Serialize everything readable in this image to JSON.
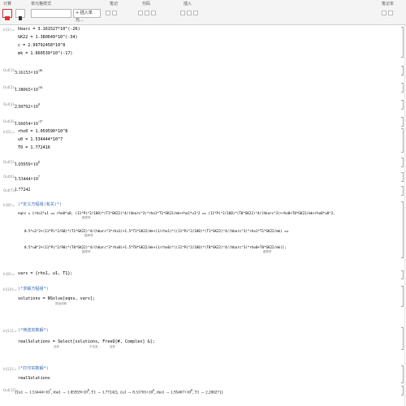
{
  "toolbar": {
    "groups": [
      "计算",
      "单元格样式",
      "笔记",
      "代码",
      "插入",
      "笔记本"
    ],
    "style_select": "",
    "insert_label": "+ 插入单元..."
  },
  "cells": {
    "in1": {
      "label": "In[1]:=",
      "l1": "hbarc = 3.161527*10^(-26)",
      "l2": "GK22 = 1.380649*10^(-34)",
      "l3": "c = 2.99792458*10^8",
      "l4": "mk = 1.660539*10^(-17)"
    },
    "out1": [
      {
        "label": "Out[1]=",
        "mant": "3.16153",
        "exp": "-26"
      },
      {
        "label": "Out[2]=",
        "mant": "1.38065",
        "exp": "-34"
      },
      {
        "label": "Out[3]=",
        "mant": "2.99792",
        "exp": "8"
      },
      {
        "label": "Out[4]=",
        "mant": "1.66054",
        "exp": "-17"
      }
    ],
    "in2": {
      "label": "In[5]:=",
      "l1": "rho0 = 1.059590*10^8",
      "l2": "u0 = 1.534444*10^7",
      "l3": "T0 = 1.772416"
    },
    "out2": [
      {
        "label": "Out[5]=",
        "mant": "1.05959",
        "exp": "8"
      },
      {
        "label": "Out[6]=",
        "mant": "1.53444",
        "exp": "7"
      },
      {
        "label": "Out[7]=",
        "mant": "1.77242",
        "exp": ""
      }
    ],
    "eq": {
      "label": "In[8]:=",
      "comment": "(*定义方程组(有关)*)",
      "l1": "eqns = {rho1*u1 == rho0*u0, (11*Pi^2/180)*(T1*GK22)^4/(hbarc^3)*rho1*T1*GK22/mk+rho1*u1^2 == (11*Pi^2/180)*(T0*GK22)^4/(hbarc^3)+rho0+T0*GK22/mk+rho0*u0^2,",
      "l2": "0.5*u1^2+(11*Pi^2/60)*(T1*GK22)^4/(hbarc^3*rho1)+1.5*T1*GK22/mk+(1/rho1)*((11*Pi^2/180)*(T1*GK22)^4/(hbarc^3)*rho1*T1*GK22/mk) ==",
      "l3": "0.5*u0^2+(11*Pi^2/90)*(T0*GK22)^4/(hbarc^3*rho0)+1.5*T0*GK22/mk+(1/rho0)*((11*Pi^2/180)*(T0*GK22)^4/(hbarc^3)*rho0+T0*GK22/mk)};",
      "hint1": "圆周率",
      "hint2": "圆周率",
      "hint3": "圆周率",
      "hint4": "圆周率"
    },
    "vars": {
      "label": "In[9]:=",
      "text": "vars = {rho1, u1, T1};"
    },
    "solve": {
      "label": "In[10]:=",
      "comment": "(*求解方程组*)",
      "text": "solutions = NSolve[eqns, vars];",
      "hint": "数值求解"
    },
    "select": {
      "label": "In[11]:=",
      "comment": "(*筛选实数解*)",
      "text": "realSolutions = Select[solutions, FreeQ[#, Complex] &];",
      "hint1": "选择",
      "hint2": "不含某...",
      "hint3": "复数"
    },
    "print": {
      "label": "In[12]:=",
      "comment": "(*打印实数解*)",
      "text": "realSolutions"
    },
    "result": {
      "label": "Out[12]=",
      "p1": "{{u1 → 1.53444×10",
      "e1": "7",
      "p2": ", rho1 → 1.05959×10",
      "e2": "8",
      "p3": ", T1 → 1.77242}, {u1 → 8.31765×10",
      "e3": "6",
      "p4": ", rho1 → 1.95467×10",
      "e4": "8",
      "p5": ", T1 → 2.20027}}"
    }
  },
  "colors": {
    "comment": "#3d6bb4",
    "bracket": "#9aabbb",
    "toolbar": "#f4f4f4"
  }
}
